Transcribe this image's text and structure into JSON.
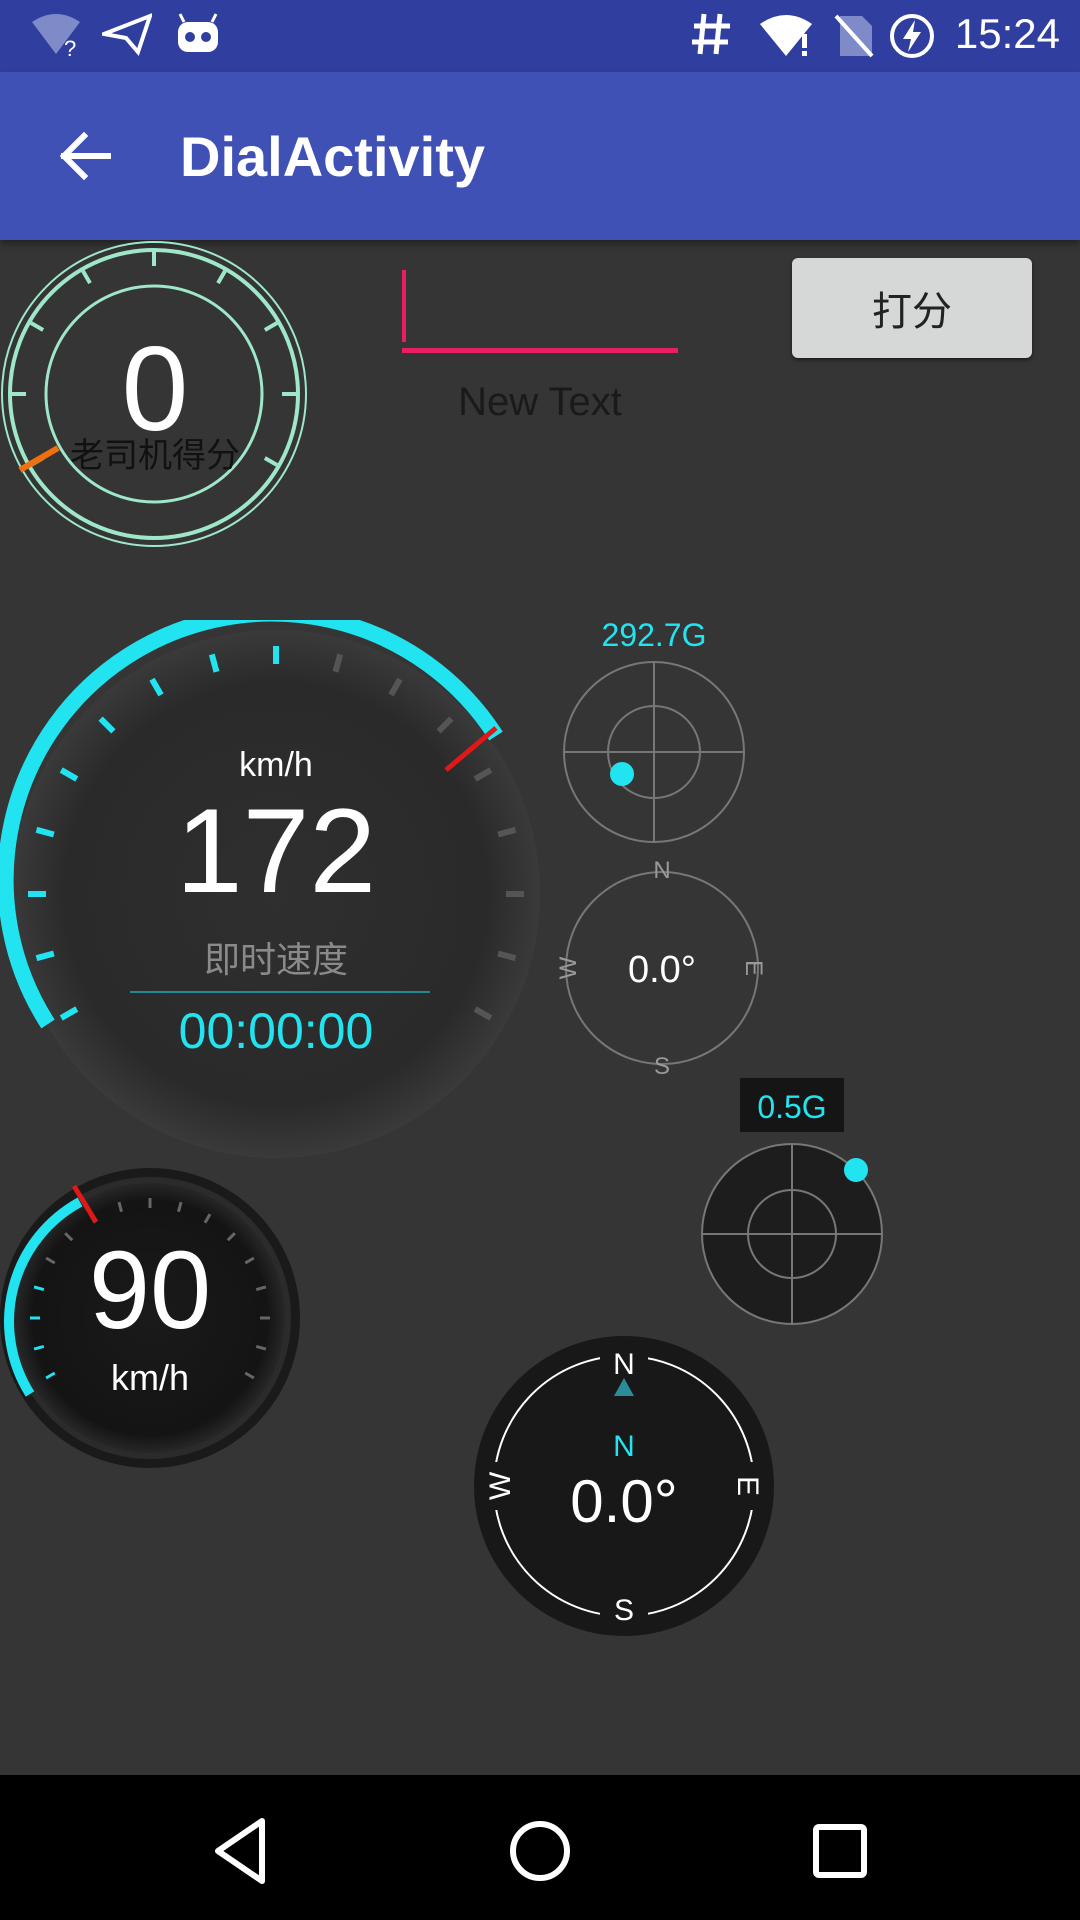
{
  "status_bar": {
    "time": "15:24",
    "icons": [
      "wifi-question-icon",
      "send-icon",
      "android-icon",
      "hash-icon",
      "wifi-alert-icon",
      "no-sim-icon",
      "battery-charging-icon"
    ]
  },
  "app_bar": {
    "title": "DialActivity",
    "back_icon": "arrow-back-icon"
  },
  "score_dial": {
    "value": "0",
    "label": "老司机得分"
  },
  "text_input": {
    "value": ""
  },
  "new_text": "New Text",
  "rate_button": {
    "label": "打分"
  },
  "speedometer": {
    "unit": "km/h",
    "value": "172",
    "label": "即时速度",
    "timer": "00:00:00",
    "accent": "#22E4F0"
  },
  "g_sensor_top": {
    "value": "292.7G"
  },
  "compass_small": {
    "n": "N",
    "s": "S",
    "e": "E",
    "w": "W",
    "heading": "0.0°"
  },
  "g_sensor_dark": {
    "value": "0.5G"
  },
  "speedometer_small": {
    "value": "90",
    "unit": "km/h"
  },
  "compass_dark": {
    "n": "N",
    "s": "S",
    "e": "E",
    "w": "W",
    "direction": "N",
    "heading": "0.0°"
  },
  "nav_bar": {
    "back": "back-icon",
    "home": "home-icon",
    "recents": "recents-icon"
  }
}
